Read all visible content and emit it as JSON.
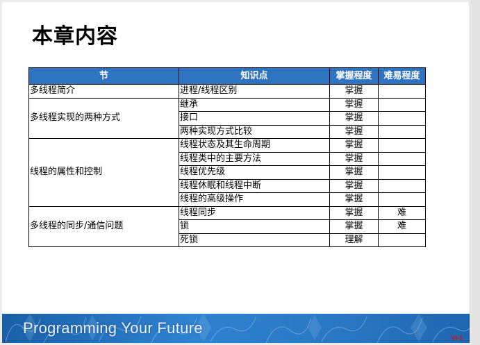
{
  "slide": {
    "title": "本章内容",
    "table": {
      "headers": [
        "节",
        "知识点",
        "掌握程度",
        "难易程度"
      ],
      "sections": [
        {
          "name": "多线程简介",
          "rows": [
            {
              "point": "进程/线程区别",
              "mastery": "掌握",
              "difficulty": ""
            }
          ]
        },
        {
          "name": "多线程实现的两种方式",
          "rows": [
            {
              "point": "继承",
              "mastery": "掌握",
              "difficulty": ""
            },
            {
              "point": "接口",
              "mastery": "掌握",
              "difficulty": ""
            },
            {
              "point": "两种实现方式比较",
              "mastery": "掌握",
              "difficulty": ""
            }
          ]
        },
        {
          "name": "线程的属性和控制",
          "rows": [
            {
              "point": "线程状态及其生命周期",
              "mastery": "掌握",
              "difficulty": ""
            },
            {
              "point": "线程类中的主要方法",
              "mastery": "掌握",
              "difficulty": ""
            },
            {
              "point": "线程优先级",
              "mastery": "掌握",
              "difficulty": ""
            },
            {
              "point": "线程休眠和线程中断",
              "mastery": "掌握",
              "difficulty": ""
            },
            {
              "point": "线程的高级操作",
              "mastery": "掌握",
              "difficulty": ""
            }
          ]
        },
        {
          "name": "多线程的同步/通信问题",
          "rows": [
            {
              "point": "线程同步",
              "mastery": "掌握",
              "difficulty": "难"
            },
            {
              "point": "锁",
              "mastery": "掌握",
              "difficulty": "难"
            },
            {
              "point": "死锁",
              "mastery": "理解",
              "difficulty": ""
            }
          ]
        }
      ]
    },
    "banner_text": "Programming Your Future",
    "page_number": "VI-1"
  },
  "colors": {
    "header_bg": "#2f74c0",
    "banner_bg": "#2a78c4",
    "page_number": "#d01010"
  }
}
